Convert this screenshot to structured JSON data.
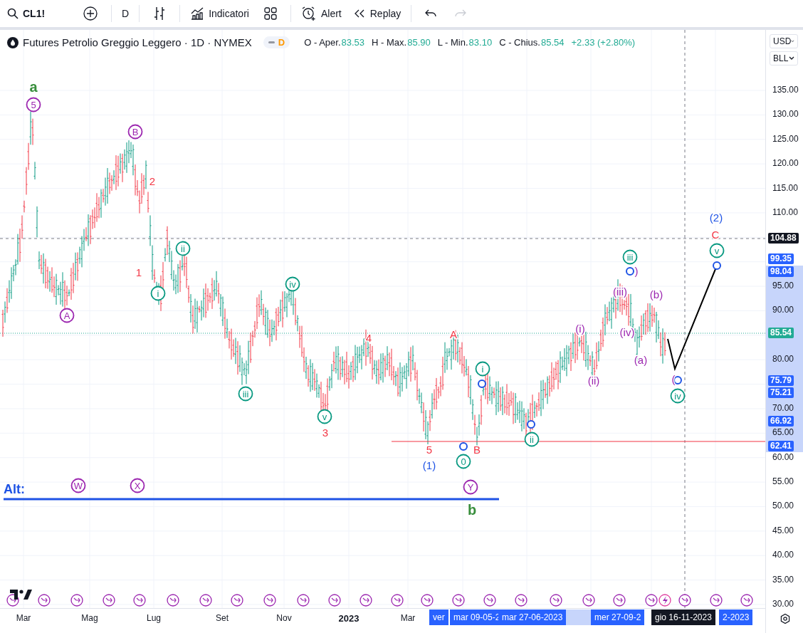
{
  "toolbar": {
    "symbol": "CL1!",
    "interval": "D",
    "indicators": "Indicatori",
    "alert": "Alert",
    "replay": "Replay",
    "redo_disabled": true
  },
  "legend": {
    "title": "Futures Petrolio Greggio Leggero · 1D · NYMEX",
    "interval_badge": "D",
    "ohlc": [
      {
        "label": "O - Aper.",
        "value": "83.53"
      },
      {
        "label": "H - Max.",
        "value": "85.90"
      },
      {
        "label": "L - Min.",
        "value": "83.10"
      },
      {
        "label": "C - Chius.",
        "value": "85.54"
      }
    ],
    "change": "+2.33 (+2.80%)"
  },
  "price_axis": {
    "currency": "USD",
    "unit": "BLL",
    "ticks": [
      "135.00",
      "130.00",
      "125.00",
      "120.00",
      "115.00",
      "110.00",
      "95.00",
      "90.00",
      "80.00",
      "70.00",
      "65.00",
      "60.00",
      "55.00",
      "50.00",
      "45.00",
      "40.00",
      "35.00",
      "30.00"
    ],
    "badges": [
      {
        "text": "104.88",
        "color": "#131722"
      },
      {
        "text": "99.35",
        "color": "#2962ff"
      },
      {
        "text": "98.04",
        "color": "#2962ff"
      },
      {
        "text": "85.54",
        "color": "#22ab94"
      },
      {
        "text": "75.79",
        "color": "#2962ff"
      },
      {
        "text": "75.21",
        "color": "#2962ff"
      },
      {
        "text": "66.92",
        "color": "#2962ff"
      },
      {
        "text": "62.41",
        "color": "#2962ff"
      }
    ]
  },
  "time_axis": {
    "ticks": [
      {
        "text": "Mar",
        "bold": false
      },
      {
        "text": "Mag",
        "bold": false
      },
      {
        "text": "Lug",
        "bold": false
      },
      {
        "text": "Set",
        "bold": false
      },
      {
        "text": "Nov",
        "bold": false
      },
      {
        "text": "2023",
        "bold": true
      },
      {
        "text": "Mar",
        "bold": false
      }
    ],
    "badges": [
      {
        "text": "ver",
        "color": "#2962ff"
      },
      {
        "text": "mar 09-05-2",
        "color": "#2962ff"
      },
      {
        "text": "mar 27-06-2023",
        "color": "#2962ff"
      },
      {
        "text": "mer 27-09-2",
        "color": "#2962ff"
      },
      {
        "text": "gio 16-11-2023",
        "color": "#131722"
      },
      {
        "text": "2-2023",
        "color": "#2962ff"
      }
    ]
  },
  "wave_labels": [
    {
      "text": "a",
      "kind": "big",
      "color": "#388e3c"
    },
    {
      "text": "5",
      "kind": "circled",
      "color": "#9c27b0"
    },
    {
      "text": "B",
      "kind": "circled",
      "color": "#9c27b0"
    },
    {
      "text": "2",
      "kind": "plain",
      "color": "#f23645"
    },
    {
      "text": "1",
      "kind": "plain",
      "color": "#f23645"
    },
    {
      "text": "A",
      "kind": "circled",
      "color": "#9c27b0"
    },
    {
      "text": "i",
      "kind": "circled",
      "color": "#089981"
    },
    {
      "text": "ii",
      "kind": "circled",
      "color": "#089981"
    },
    {
      "text": "iii",
      "kind": "circled",
      "color": "#089981"
    },
    {
      "text": "iv",
      "kind": "circled",
      "color": "#089981"
    },
    {
      "text": "v",
      "kind": "circled",
      "color": "#089981"
    },
    {
      "text": "3",
      "kind": "plain",
      "color": "#f23645"
    },
    {
      "text": "4",
      "kind": "plain",
      "color": "#f23645"
    },
    {
      "text": "A",
      "kind": "plain",
      "color": "#f23645"
    },
    {
      "text": "5",
      "kind": "plain",
      "color": "#f23645"
    },
    {
      "text": "(1)",
      "kind": "plain",
      "color": "#1e53e5"
    },
    {
      "text": "B",
      "kind": "plain",
      "color": "#f23645"
    },
    {
      "text": "0",
      "kind": "circled",
      "color": "#089981"
    },
    {
      "text": "i",
      "kind": "circled",
      "color": "#089981"
    },
    {
      "text": "ii",
      "kind": "circled",
      "color": "#089981"
    },
    {
      "text": "(i)",
      "kind": "plain",
      "color": "#9c27b0"
    },
    {
      "text": "(ii)",
      "kind": "plain",
      "color": "#9c27b0"
    },
    {
      "text": "iii",
      "kind": "circled",
      "color": "#089981"
    },
    {
      "text": ")",
      "kind": "plain",
      "color": "#9c27b0"
    },
    {
      "text": "(iii)",
      "kind": "plain",
      "color": "#9c27b0"
    },
    {
      "text": "(iv)",
      "kind": "plain",
      "color": "#9c27b0"
    },
    {
      "text": "(b)",
      "kind": "plain",
      "color": "#9c27b0"
    },
    {
      "text": "(a)",
      "kind": "plain",
      "color": "#9c27b0"
    },
    {
      "text": "(2)",
      "kind": "plain",
      "color": "#1e53e5"
    },
    {
      "text": "C",
      "kind": "plain",
      "color": "#f23645"
    },
    {
      "text": "v",
      "kind": "circled",
      "color": "#089981"
    },
    {
      "text": "(",
      "kind": "plain",
      "color": "#9c27b0"
    },
    {
      "text": "iv",
      "kind": "circled",
      "color": "#089981"
    },
    {
      "text": "W",
      "kind": "circled",
      "color": "#9c27b0"
    },
    {
      "text": "X",
      "kind": "circled",
      "color": "#9c27b0"
    },
    {
      "text": "Y",
      "kind": "circled",
      "color": "#9c27b0"
    },
    {
      "text": "b",
      "kind": "big",
      "color": "#388e3c"
    },
    {
      "text": "Alt:",
      "kind": "bold",
      "color": "#1e53e5"
    }
  ]
}
